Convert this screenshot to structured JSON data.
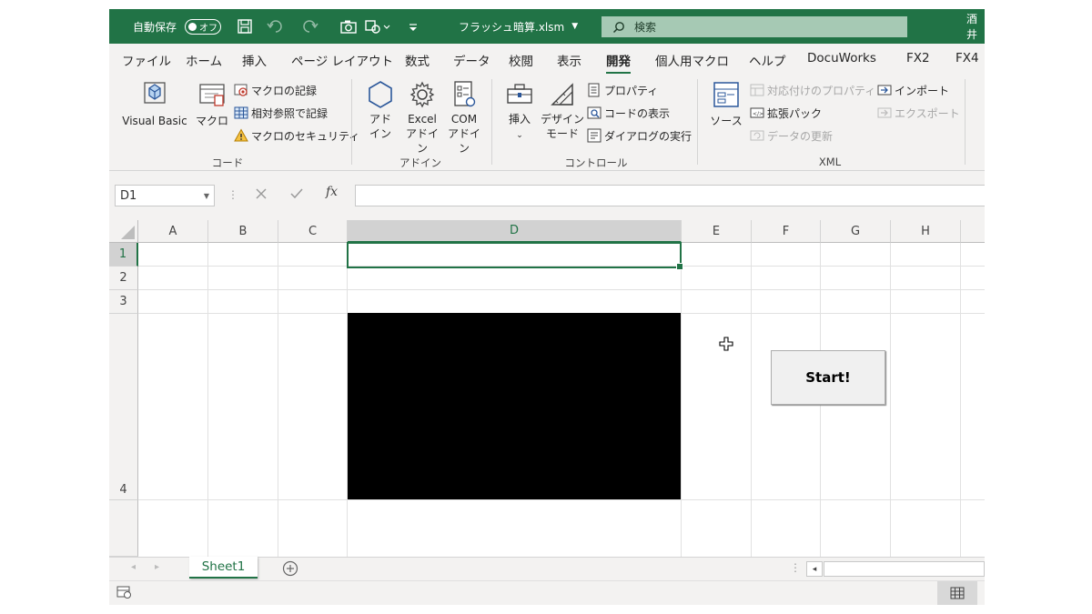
{
  "titlebar": {
    "autosave_label": "自動保存",
    "autosave_state": "オフ",
    "filename": "フラッシュ暗算.xlsm",
    "search_placeholder": "検索",
    "user_partial": "酒井"
  },
  "tabs": [
    "ファイル",
    "ホーム",
    "挿入",
    "ページ レイアウト",
    "数式",
    "データ",
    "校閲",
    "表示",
    "開発",
    "個人用マクロ",
    "ヘルプ",
    "DocuWorks",
    "FX2",
    "FX4"
  ],
  "active_tab": "開発",
  "ribbon": {
    "code": {
      "label": "コード",
      "visual_basic": "Visual Basic",
      "macro": "マクロ",
      "record_macro": "マクロの記録",
      "relative_ref": "相対参照で記録",
      "macro_security": "マクロのセキュリティ"
    },
    "addins": {
      "label": "アドイン",
      "addin_1": "アド",
      "addin_2": "イン",
      "excel_addin_1": "Excel",
      "excel_addin_2": "アドイン",
      "com_addin_1": "COM",
      "com_addin_2": "アドイン"
    },
    "controls": {
      "label": "コントロール",
      "insert": "挿入",
      "design_mode_1": "デザイン",
      "design_mode_2": "モード",
      "properties": "プロパティ",
      "view_code": "コードの表示",
      "run_dialog": "ダイアログの実行"
    },
    "xml": {
      "label": "XML",
      "source": "ソース",
      "map_properties": "対応付けのプロパティ",
      "expansion_packs": "拡張パック",
      "refresh_data": "データの更新",
      "import": "インポート",
      "export": "エクスポート"
    }
  },
  "formula_bar": {
    "name_box": "D1",
    "fx": "fx",
    "formula": ""
  },
  "grid": {
    "columns": [
      "A",
      "B",
      "C",
      "D",
      "E",
      "F",
      "G",
      "H"
    ],
    "selected_column": "D",
    "rows": [
      "1",
      "2",
      "3",
      "4"
    ],
    "selected_row": "1",
    "selected_cell": "D1",
    "button_label": "Start!"
  },
  "sheets": [
    "Sheet1"
  ],
  "colors": {
    "excel_green": "#217346",
    "ribbon_bg": "#f3f2f1",
    "black_panel": "#000000"
  }
}
